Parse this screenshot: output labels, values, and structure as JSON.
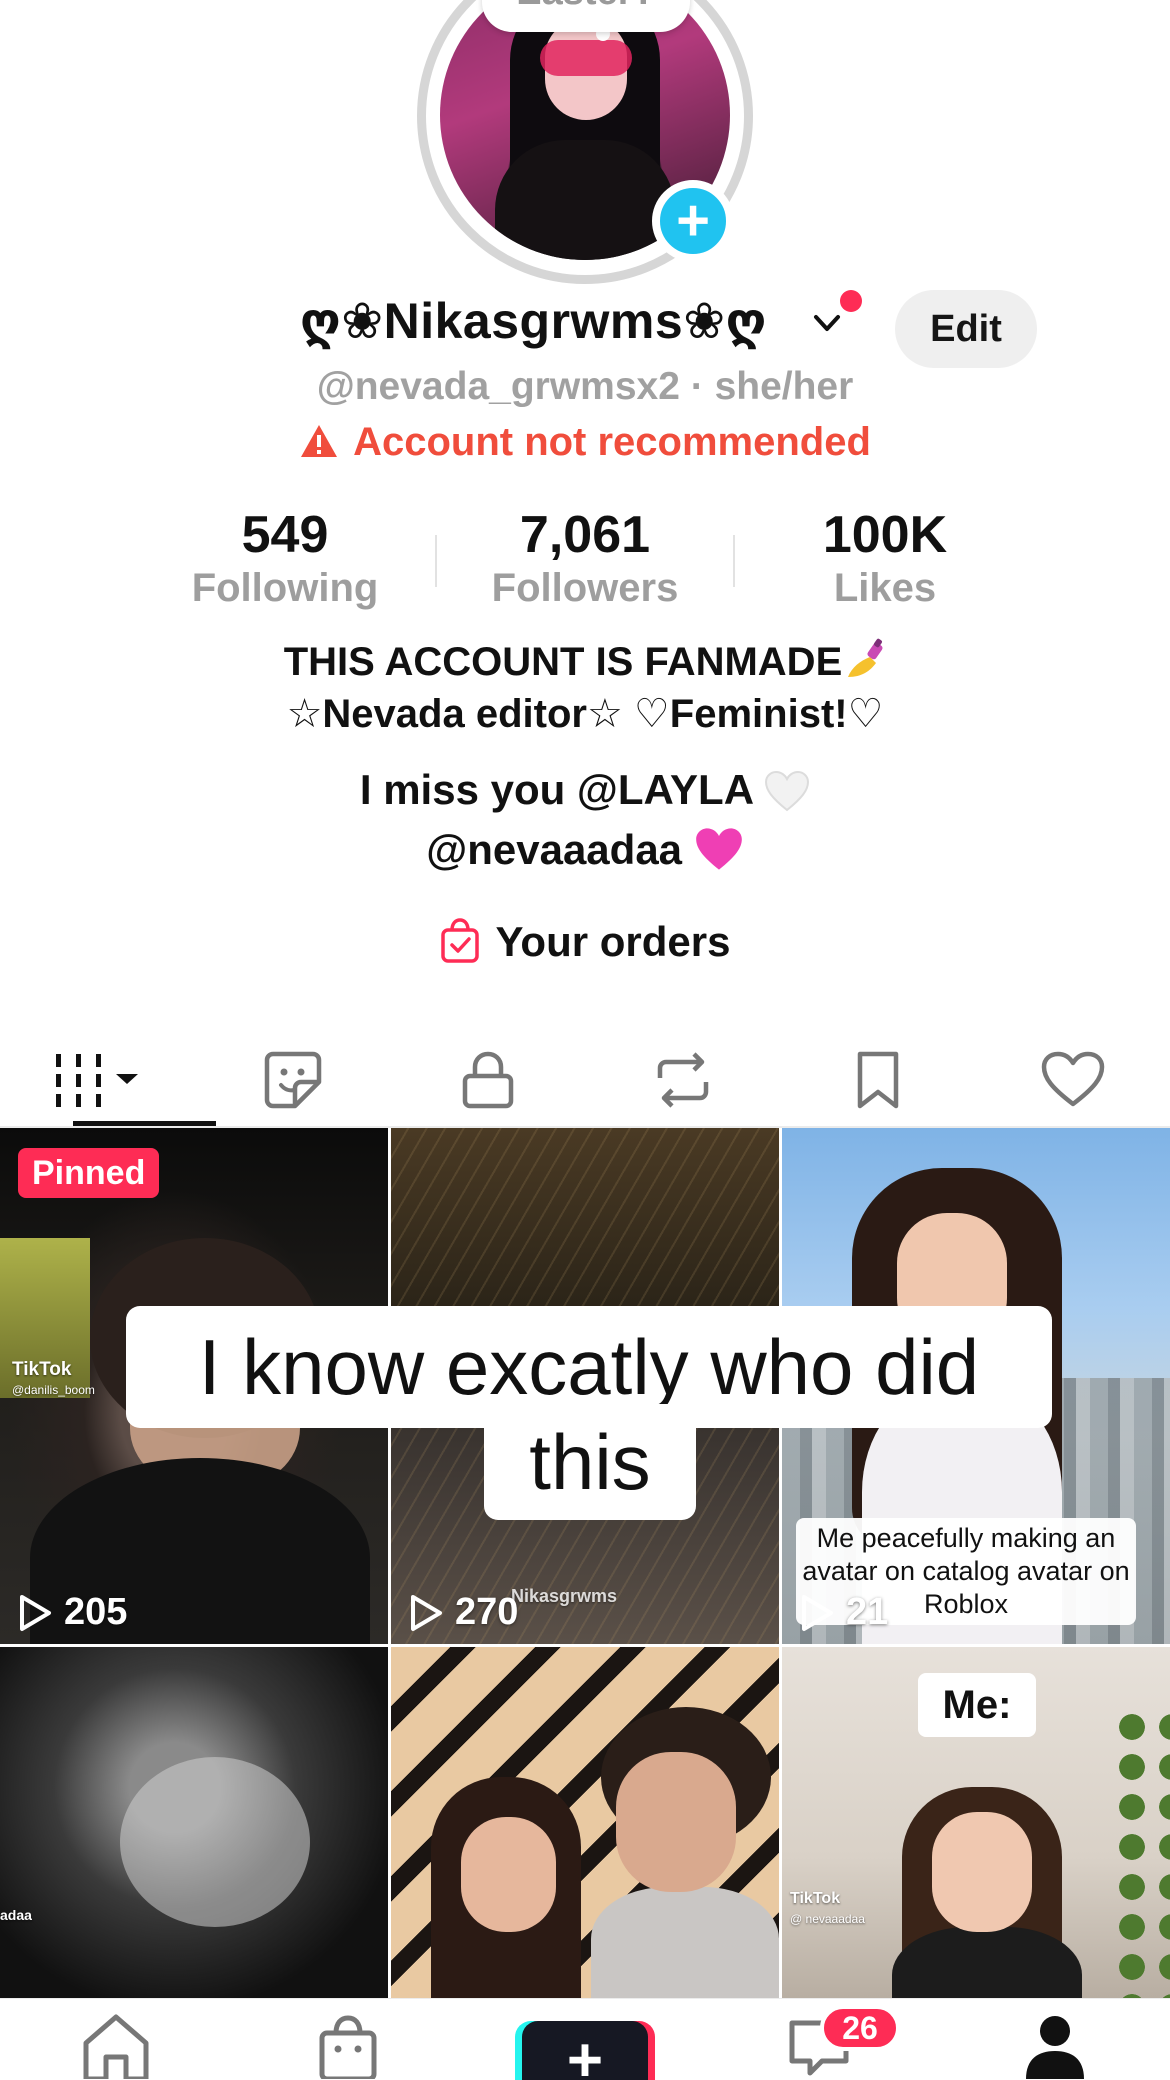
{
  "profile": {
    "note": "Easter?",
    "display_name": "ღ❀Nikasgrwms❀ღ",
    "handle_line": "@nevada_grwmsx2 · she/her",
    "warning": "Account not recommended",
    "edit_label": "Edit"
  },
  "stats": [
    {
      "value": "549",
      "label": "Following"
    },
    {
      "value": "7,061",
      "label": "Followers"
    },
    {
      "value": "100K",
      "label": "Likes"
    }
  ],
  "bio": {
    "line1": "THIS ACCOUNT IS FANMADE",
    "line2": "☆Nevada editor☆ ♡Feminist!♡",
    "line3": "I miss you @LAYLA",
    "line4": "@nevaaadaa"
  },
  "orders_label": "Your orders",
  "tabs": [
    {
      "icon": "grid-icon"
    },
    {
      "icon": "sticker-icon"
    },
    {
      "icon": "lock-icon"
    },
    {
      "icon": "repost-icon"
    },
    {
      "icon": "bookmark-icon"
    },
    {
      "icon": "heart-icon"
    }
  ],
  "videos": [
    {
      "pinned": "Pinned",
      "plays": "205",
      "watermark": "TikTok",
      "watermark_user": "@danilis_boom"
    },
    {
      "plays": "270",
      "watermark_user": "Nikasgrwms"
    },
    {
      "plays": "21",
      "caption": "Me peacefully making an avatar on catalog avatar on Roblox"
    },
    {
      "watermark_user": "adaa"
    },
    {},
    {
      "caption": "Me:",
      "watermark": "TikTok",
      "watermark_user": "@ nevaaadaa"
    }
  ],
  "overlay_caption": {
    "line1": "I know excatly who did",
    "line2": "this"
  },
  "bottom_nav": {
    "inbox_badge": "26"
  },
  "colors": {
    "accent": "#fe2c55",
    "warning": "#f04d3c",
    "cyan": "#20c3f0"
  }
}
